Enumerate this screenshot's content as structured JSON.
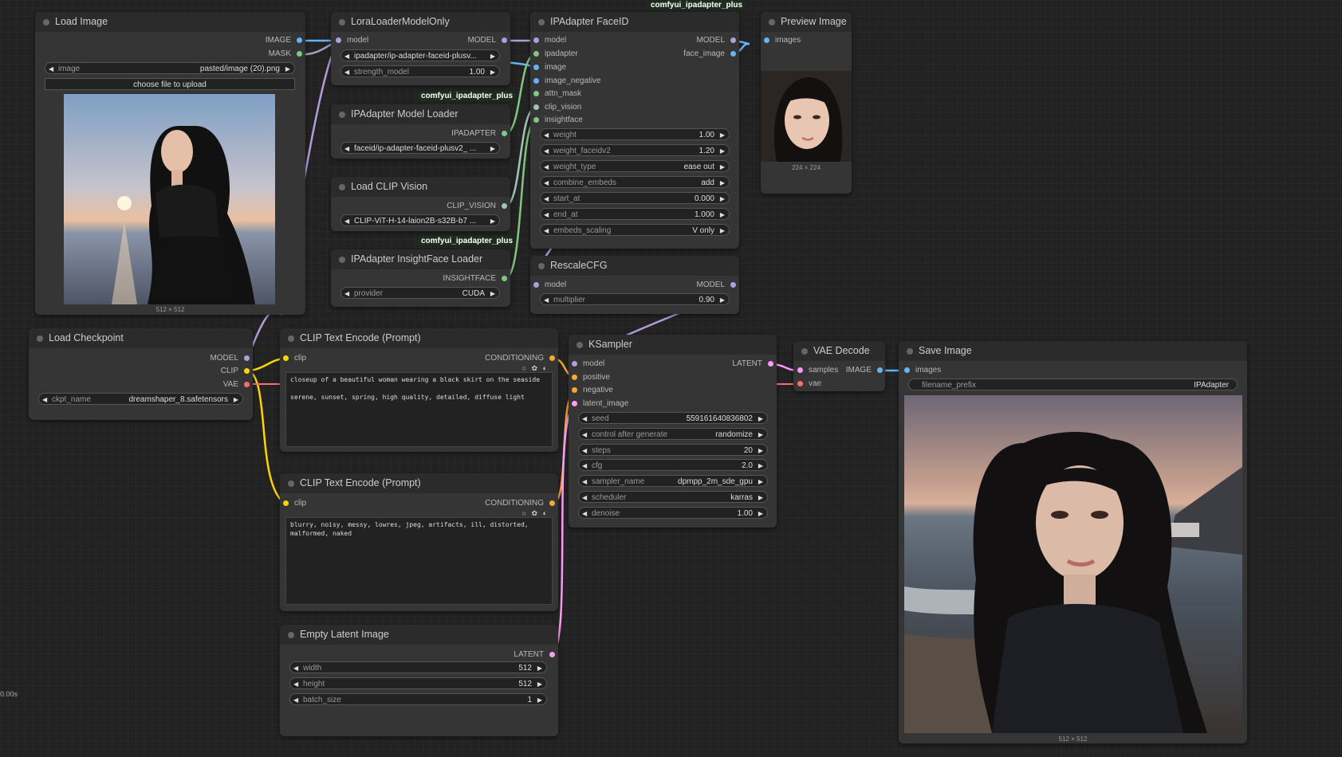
{
  "timer": "0.00s",
  "colors": {
    "model": "#b39ddb",
    "clip": "#ffd500",
    "vae": "#ff6e6e",
    "conditioning": "#ffa931",
    "latent": "#ff9cf9",
    "image": "#64b5f6",
    "mask": "#81c784",
    "ipadapter": "#81c784",
    "clip_vision": "#a1c7b4",
    "insightface": "#81c784"
  },
  "badges": {
    "ipadapter_plus_1": "comfyui_ipadapter_plus",
    "ipadapter_plus_2": "comfyui_ipadapter_plus",
    "ipadapter_plus_3": "comfyui_ipadapter_plus"
  },
  "load_image": {
    "title": "Load Image",
    "out_image": "IMAGE",
    "out_mask": "MASK",
    "image_label": "image",
    "image_value": "pasted/image (20).png",
    "upload_button": "choose file to upload",
    "caption": "512 × 512"
  },
  "lora": {
    "title": "LoraLoaderModelOnly",
    "in_model": "model",
    "out_model": "MODEL",
    "lora_value": "ipadapter/ip-adapter-faceid-plusv...",
    "strength_label": "strength_model",
    "strength_value": "1.00"
  },
  "ipa_loader": {
    "title": "IPAdapter Model Loader",
    "out": "IPADAPTER",
    "file_value": "faceid/ip-adapter-faceid-plusv2_ ..."
  },
  "clip_vision": {
    "title": "Load CLIP Vision",
    "out": "CLIP_VISION",
    "file_value": "CLIP-ViT-H-14-laion2B-s32B-b7 ..."
  },
  "insightface": {
    "title": "IPAdapter InsightFace Loader",
    "out": "INSIGHTFACE",
    "provider_label": "provider",
    "provider_value": "CUDA"
  },
  "faceid": {
    "title": "IPAdapter FaceID",
    "inputs": [
      "model",
      "ipadapter",
      "image",
      "image_negative",
      "attn_mask",
      "clip_vision",
      "insightface"
    ],
    "out_model": "MODEL",
    "out_face": "face_image",
    "widgets": [
      {
        "label": "weight",
        "value": "1.00"
      },
      {
        "label": "weight_faceidv2",
        "value": "1.20"
      },
      {
        "label": "weight_type",
        "value": "ease out"
      },
      {
        "label": "combine_embeds",
        "value": "add"
      },
      {
        "label": "start_at",
        "value": "0.000"
      },
      {
        "label": "end_at",
        "value": "1.000"
      },
      {
        "label": "embeds_scaling",
        "value": "V only"
      }
    ]
  },
  "preview": {
    "title": "Preview Image",
    "in": "images",
    "caption": "224 × 224"
  },
  "rescale": {
    "title": "RescaleCFG",
    "in": "model",
    "out": "MODEL",
    "mult_label": "multiplier",
    "mult_value": "0.90"
  },
  "checkpoint": {
    "title": "Load Checkpoint",
    "out_model": "MODEL",
    "out_clip": "CLIP",
    "out_vae": "VAE",
    "ckpt_label": "ckpt_name",
    "ckpt_value": "dreamshaper_8.safetensors"
  },
  "clip_pos": {
    "title": "CLIP Text Encode (Prompt)",
    "in": "clip",
    "out": "CONDITIONING",
    "text": "closeup of a beautiful woman wearing a black skirt on the seaside\n\nserene, sunset, spring, high quality, detailed, diffuse light"
  },
  "clip_neg": {
    "title": "CLIP Text Encode (Prompt)",
    "in": "clip",
    "out": "CONDITIONING",
    "text": "blurry, noisy, messy, lowres, jpeg, artifacts, ill, distorted,\nmalformed, naked"
  },
  "empty_latent": {
    "title": "Empty Latent Image",
    "out": "LATENT",
    "widgets": [
      {
        "label": "width",
        "value": "512"
      },
      {
        "label": "height",
        "value": "512"
      },
      {
        "label": "batch_size",
        "value": "1"
      }
    ]
  },
  "ksampler": {
    "title": "KSampler",
    "inputs": [
      "model",
      "positive",
      "negative",
      "latent_image"
    ],
    "out": "LATENT",
    "widgets": [
      {
        "label": "seed",
        "value": "559161640836802"
      },
      {
        "label": "control after generate",
        "value": "randomize"
      },
      {
        "label": "steps",
        "value": "20"
      },
      {
        "label": "cfg",
        "value": "2.0"
      },
      {
        "label": "sampler_name",
        "value": "dpmpp_2m_sde_gpu"
      },
      {
        "label": "scheduler",
        "value": "karras"
      },
      {
        "label": "denoise",
        "value": "1.00"
      }
    ]
  },
  "vae_decode": {
    "title": "VAE Decode",
    "in_samples": "samples",
    "in_vae": "vae",
    "out": "IMAGE"
  },
  "save": {
    "title": "Save Image",
    "in": "images",
    "prefix_label": "filename_prefix",
    "prefix_value": "IPAdapter",
    "caption": "512 × 512"
  }
}
